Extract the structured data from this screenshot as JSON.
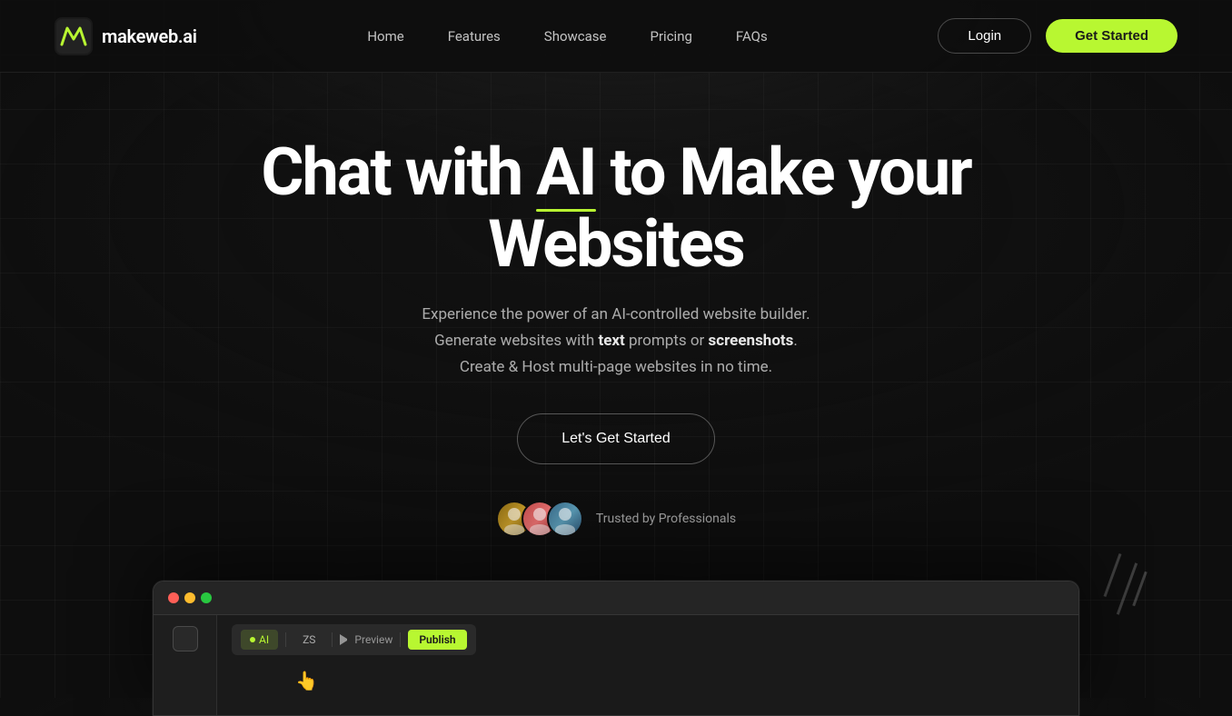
{
  "brand": {
    "name": "makeweb.ai",
    "logo_alt": "MakeWeb AI logo"
  },
  "navbar": {
    "home": "Home",
    "features": "Features",
    "showcase": "Showcase",
    "pricing": "Pricing",
    "faqs": "FAQs",
    "login": "Login",
    "get_started": "Get Started"
  },
  "hero": {
    "title_part1": "Chat with ",
    "title_ai": "AI",
    "title_part2": " to Make your Websites",
    "subtitle_line1": "Experience the power of an AI-controlled website builder.",
    "subtitle_line2_prefix": "Generate websites with ",
    "subtitle_text": "text",
    "subtitle_line2_mid": " prompts or ",
    "subtitle_screenshots": "screenshots",
    "subtitle_line2_suffix": ".",
    "subtitle_line3": "Create & Host multi-page websites in no time.",
    "cta_button": "Let's Get Started"
  },
  "trust": {
    "label": "Trusted by Professionals"
  },
  "browser": {
    "tab_ai": "AI",
    "tab_zs": "ZS",
    "tab_preview": "Preview",
    "tab_publish": "Publish"
  },
  "colors": {
    "accent": "#b8f731",
    "background": "#0e0e0e",
    "text_primary": "#ffffff",
    "text_muted": "rgba(255,255,255,0.65)"
  }
}
